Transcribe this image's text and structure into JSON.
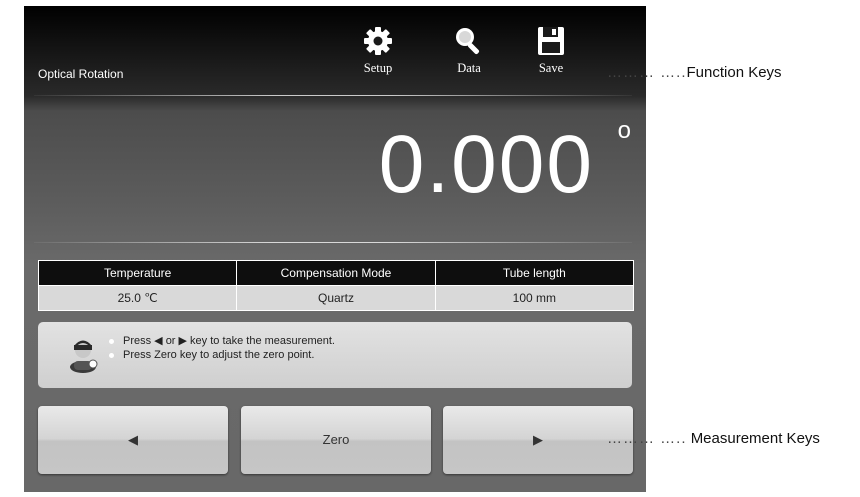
{
  "header": {
    "title": "Optical Rotation",
    "function_keys": [
      {
        "label": "Setup",
        "icon": "gear-icon"
      },
      {
        "label": "Data",
        "icon": "magnifier-icon"
      },
      {
        "label": "Save",
        "icon": "floppy-disk-icon"
      }
    ]
  },
  "reading": {
    "value": "0.000",
    "unit": "o"
  },
  "info": {
    "headers": [
      "Temperature",
      "Compensation Mode",
      "Tube length"
    ],
    "values": [
      "25.0 ℃",
      "Quartz",
      "100  mm"
    ]
  },
  "message": {
    "line1": "Press ◀ or ▶ key to take the measurement.",
    "line2": "Press Zero key to adjust the zero point."
  },
  "measurement_keys": {
    "left": "◀",
    "zero": "Zero",
    "right": "▶"
  },
  "annotations": {
    "dots1": "……… …..",
    "function_keys": "Function Keys",
    "dots2": "……… …..",
    "measurement_keys": "Measurement Keys"
  },
  "colors": {
    "screen_top": "#000000",
    "screen_bottom": "#686868",
    "text": "#ffffff"
  }
}
